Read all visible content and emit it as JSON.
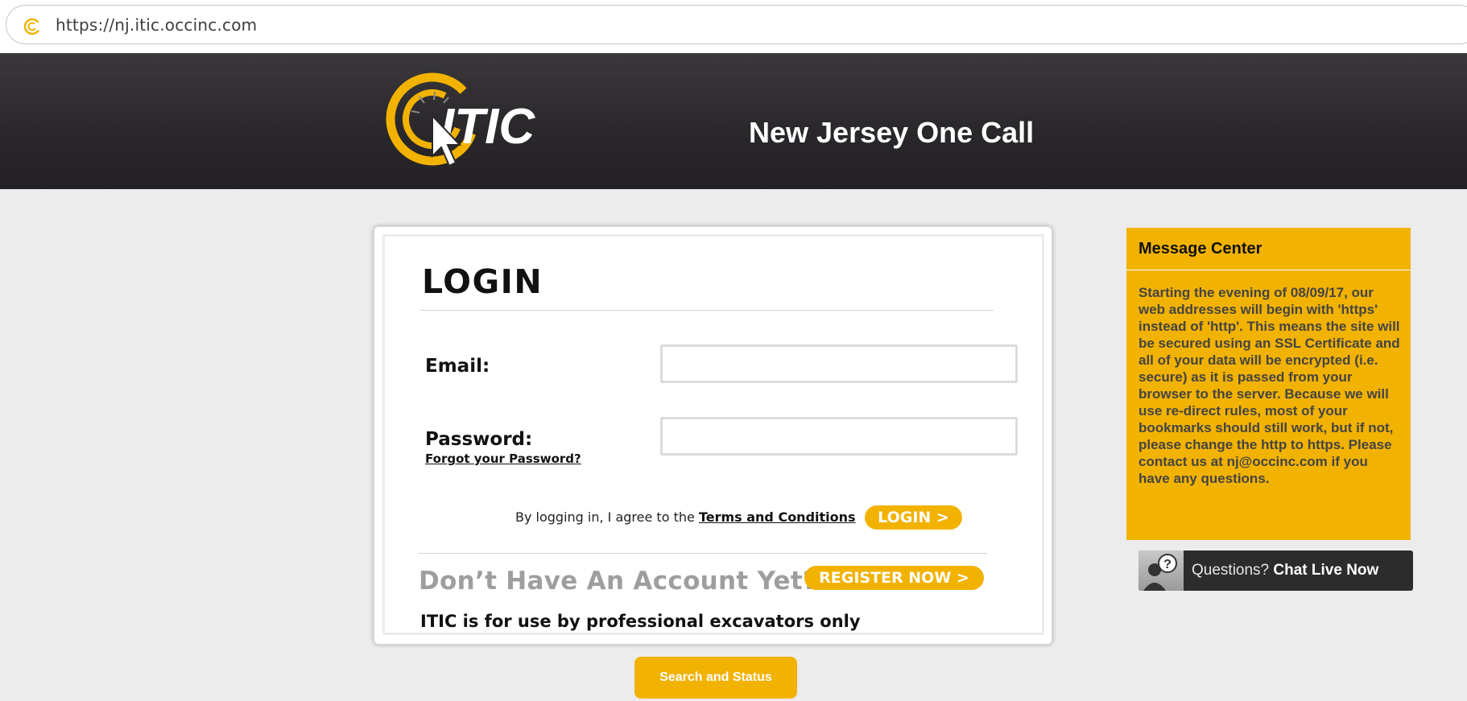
{
  "browser": {
    "url": "https://nj.itic.occinc.com"
  },
  "header": {
    "logo_text": "ITIC",
    "site_title": "New Jersey One Call"
  },
  "login": {
    "title": "LOGIN",
    "email_label": "Email:",
    "email_value": "",
    "password_label": "Password:",
    "password_value": "",
    "forgot_link": "Forgot your Password?",
    "agree_text": "By logging in, I agree to the",
    "terms_link": "Terms and Conditions",
    "login_button": "LOGIN >",
    "no_account_text": "Don’t Have An Account Yet?",
    "register_button": "REGISTER NOW >",
    "professional_notice": "ITIC is for use by professional excavators only"
  },
  "search_button": "Search and Status",
  "message_center": {
    "title": "Message Center",
    "body": "Starting the evening of 08/09/17, our web addresses will begin with 'https' instead of 'http'. This means the site will be secured using an SSL Certificate and all of your data will be encrypted (i.e. secure) as it is passed from your browser to the server. Because we will use re-direct rules, most of your bookmarks should still work, but if not, please change the http to https. Please contact us at nj@occinc.com if you have any questions."
  },
  "chat": {
    "prefix": "Questions?",
    "action": "Chat Live Now"
  },
  "colors": {
    "accent": "#f2b200",
    "header_bg": "#2a282b",
    "page_bg": "#ececec"
  }
}
